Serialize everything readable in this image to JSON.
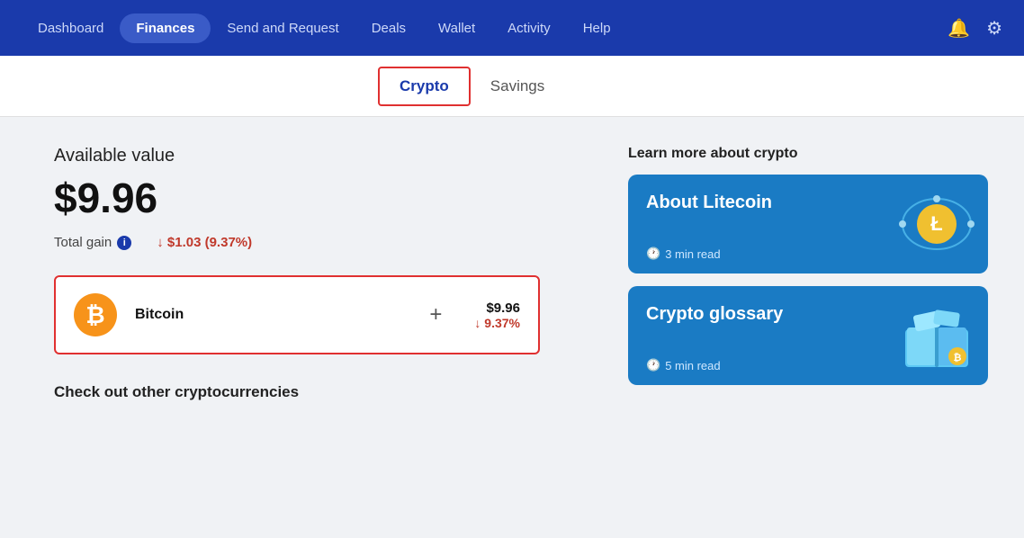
{
  "navbar": {
    "items": [
      {
        "label": "Dashboard",
        "active": false
      },
      {
        "label": "Finances",
        "active": true
      },
      {
        "label": "Send and Request",
        "active": false
      },
      {
        "label": "Deals",
        "active": false
      },
      {
        "label": "Wallet",
        "active": false
      },
      {
        "label": "Activity",
        "active": false
      },
      {
        "label": "Help",
        "active": false
      }
    ]
  },
  "tabs": [
    {
      "label": "Crypto",
      "active": true
    },
    {
      "label": "Savings",
      "active": false
    }
  ],
  "main": {
    "available_label": "Available value",
    "available_value": "$9.96",
    "total_gain_label": "Total gain",
    "total_gain_value": "↓ $1.03 (9.37%)",
    "bitcoin_card": {
      "name": "Bitcoin",
      "plus": "+",
      "amount": "$9.96",
      "change": "↓ 9.37%"
    },
    "check_other_label": "Check out other cryptocurrencies"
  },
  "right": {
    "learn_label": "Learn more about crypto",
    "cards": [
      {
        "title": "About Litecoin",
        "time": "3 min read"
      },
      {
        "title": "Crypto glossary",
        "time": "5 min read"
      }
    ]
  }
}
